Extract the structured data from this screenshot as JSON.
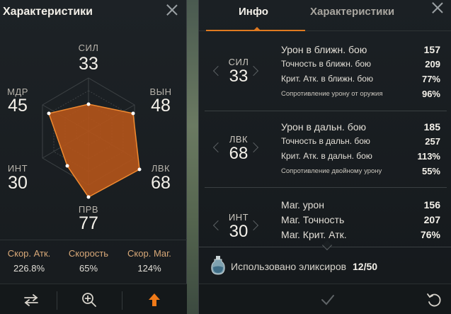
{
  "left": {
    "title": "Характеристики",
    "stats": {
      "sil": {
        "label": "СИЛ",
        "value": "33"
      },
      "vyn": {
        "label": "ВЫН",
        "value": "48"
      },
      "lvk": {
        "label": "ЛВК",
        "value": "68"
      },
      "prv": {
        "label": "ПРВ",
        "value": "77"
      },
      "int": {
        "label": "ИНТ",
        "value": "30"
      },
      "mdr": {
        "label": "МДР",
        "value": "45"
      }
    },
    "speeds": [
      {
        "label": "Скор. Атк.",
        "value": "226.8%"
      },
      {
        "label": "Скорость",
        "value": "65%"
      },
      {
        "label": "Скор. Маг.",
        "value": "124%"
      }
    ],
    "bottom_buttons": [
      "swap-icon",
      "zoom-in-icon",
      "upgrade-arrow-icon"
    ]
  },
  "right": {
    "tabs": {
      "info": "Инфо",
      "chars": "Характеристики"
    },
    "sections": [
      {
        "stat_label": "СИЛ",
        "stat_value": "33",
        "rows": [
          {
            "label": "Урон в ближн. бою",
            "value": "157"
          },
          {
            "label": "Точность в ближн. бою",
            "value": "209"
          },
          {
            "label": "Крит. Атк. в ближн. бою",
            "value": "77%"
          },
          {
            "label": "Сопротивление урону от оружия",
            "value": "96%"
          }
        ]
      },
      {
        "stat_label": "ЛВК",
        "stat_value": "68",
        "rows": [
          {
            "label": "Урон в дальн. бою",
            "value": "185"
          },
          {
            "label": "Точность в дальн. бою",
            "value": "257"
          },
          {
            "label": "Крит. Атк. в дальн. бою",
            "value": "113%"
          },
          {
            "label": "Сопротивление двойному урону",
            "value": "55%"
          }
        ]
      },
      {
        "stat_label": "ИНТ",
        "stat_value": "30",
        "rows": [
          {
            "label": "Маг. урон",
            "value": "156"
          },
          {
            "label": "Маг. Точность",
            "value": "207"
          },
          {
            "label": "Маг. Крит. Атк.",
            "value": "76%"
          }
        ]
      }
    ],
    "elixir": {
      "label": "Использовано эликсиров",
      "count": "12/50"
    },
    "bottom_buttons": [
      "checkmark-icon",
      "reset-icon"
    ]
  },
  "colors": {
    "accent": "#e07a20",
    "radar_fill": "#b5541a",
    "speed_label": "#d8a878"
  }
}
